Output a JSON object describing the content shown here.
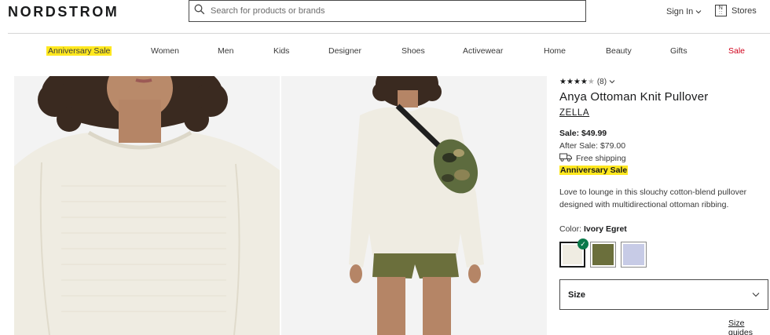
{
  "header": {
    "logo": "NORDSTROM",
    "search_placeholder": "Search for products or brands",
    "sign_in": "Sign In",
    "stores": "Stores"
  },
  "nav": {
    "items": [
      {
        "label": "Anniversary Sale",
        "style": "highlight"
      },
      {
        "label": "Women",
        "style": "normal"
      },
      {
        "label": "Men",
        "style": "normal"
      },
      {
        "label": "Kids",
        "style": "normal"
      },
      {
        "label": "Designer",
        "style": "normal"
      },
      {
        "label": "Shoes",
        "style": "normal"
      },
      {
        "label": "Activewear",
        "style": "normal"
      },
      {
        "label": "Home",
        "style": "normal"
      },
      {
        "label": "Beauty",
        "style": "normal"
      },
      {
        "label": "Gifts",
        "style": "normal"
      },
      {
        "label": "Sale",
        "style": "sale"
      }
    ]
  },
  "product": {
    "rating_stars": 4,
    "rating_max": 5,
    "review_count": "(8)",
    "title": "Anya Ottoman Knit Pullover",
    "brand": "ZELLA",
    "sale_price": "Sale: $49.99",
    "after_sale_price": "After Sale: $79.00",
    "shipping": "Free shipping",
    "badge": "Anniversary Sale",
    "description": "Love to lounge in this slouchy cotton-blend pullover designed with multidirectional ottoman ribbing.",
    "color_label": "Color:",
    "color_value": "Ivory Egret",
    "swatches": [
      {
        "name": "Ivory Egret",
        "color": "#efece2",
        "selected": true
      },
      {
        "name": "Olive",
        "color": "#6b6f3c",
        "selected": false
      },
      {
        "name": "Lavender",
        "color": "#c7cbe6",
        "selected": false
      }
    ],
    "size_label": "Size",
    "size_guides": "Size guides"
  },
  "colors": {
    "highlight": "#ffe81f",
    "sale_red": "#d0021b",
    "check_green": "#0b7a4b"
  }
}
